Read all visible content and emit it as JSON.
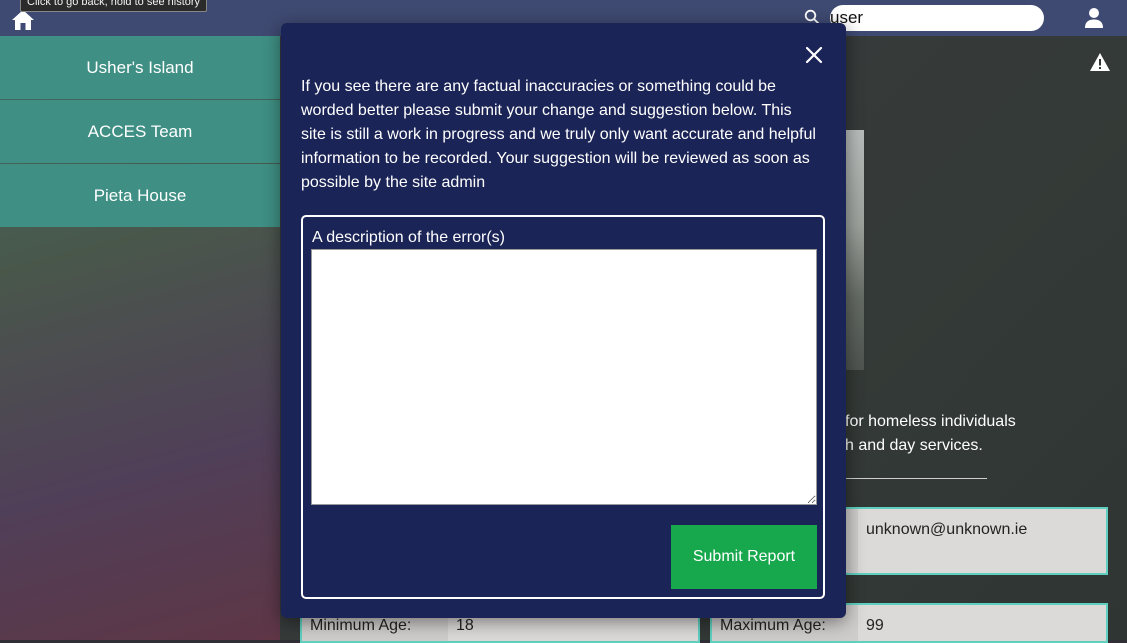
{
  "topbar": {
    "home_tooltip": "Click to go back, hold to see history",
    "search": {
      "value": "user",
      "placeholder": ""
    }
  },
  "sidebar": {
    "items": [
      {
        "label": "Usher's Island"
      },
      {
        "label": "ACCES Team"
      },
      {
        "label": "Pieta House"
      }
    ]
  },
  "background": {
    "description_line1": "for homeless individuals",
    "description_line2": "h and day services.",
    "email_value": "unknown@unknown.ie",
    "min_age_label": "Minimum Age:",
    "min_age_value": "18",
    "max_age_label": "Maximum Age:",
    "max_age_value": "99"
  },
  "modal": {
    "intro": "If you see there are any factual inaccuracies or something could be worded better please submit your change and suggestion below. This site is still a work in progress and we truly only want accurate and helpful information to be recorded. Your suggestion will be reviewed as soon as possible by the site admin",
    "field_label": "A description of the error(s)",
    "field_value": "",
    "submit_label": "Submit Report"
  },
  "colors": {
    "topbar": "#3f4a72",
    "sidebar_item": "#3f8f84",
    "modal_bg": "#1b2456",
    "submit_button": "#17a74d",
    "field_border": "#5fd0c0"
  },
  "icons": [
    "home-icon",
    "search-icon",
    "user-icon",
    "warning-icon",
    "close-icon"
  ]
}
